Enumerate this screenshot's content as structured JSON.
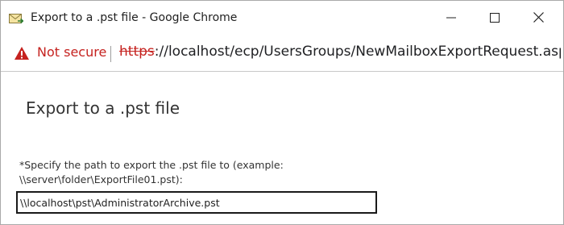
{
  "window": {
    "title": "Export to a .pst file - Google Chrome",
    "app_icon": "mail-export-icon",
    "controls": {
      "minimize_icon": "minimize-icon",
      "maximize_icon": "maximize-icon",
      "close_icon": "close-icon"
    }
  },
  "address_bar": {
    "security_icon": "warning-triangle-icon",
    "security_text": "Not secure",
    "url_scheme": "https",
    "url_rest": "://localhost/ecp/UsersGroups/NewMailboxExportRequest.aspx?...",
    "security_color": "#c5221f"
  },
  "page": {
    "title": "Export to a .pst file",
    "path_label": "*Specify the path to export the .pst file to (example: \\\\server\\folder\\ExportFile01.pst):",
    "path_value": "\\\\localhost\\pst\\AdministratorArchive.pst"
  }
}
